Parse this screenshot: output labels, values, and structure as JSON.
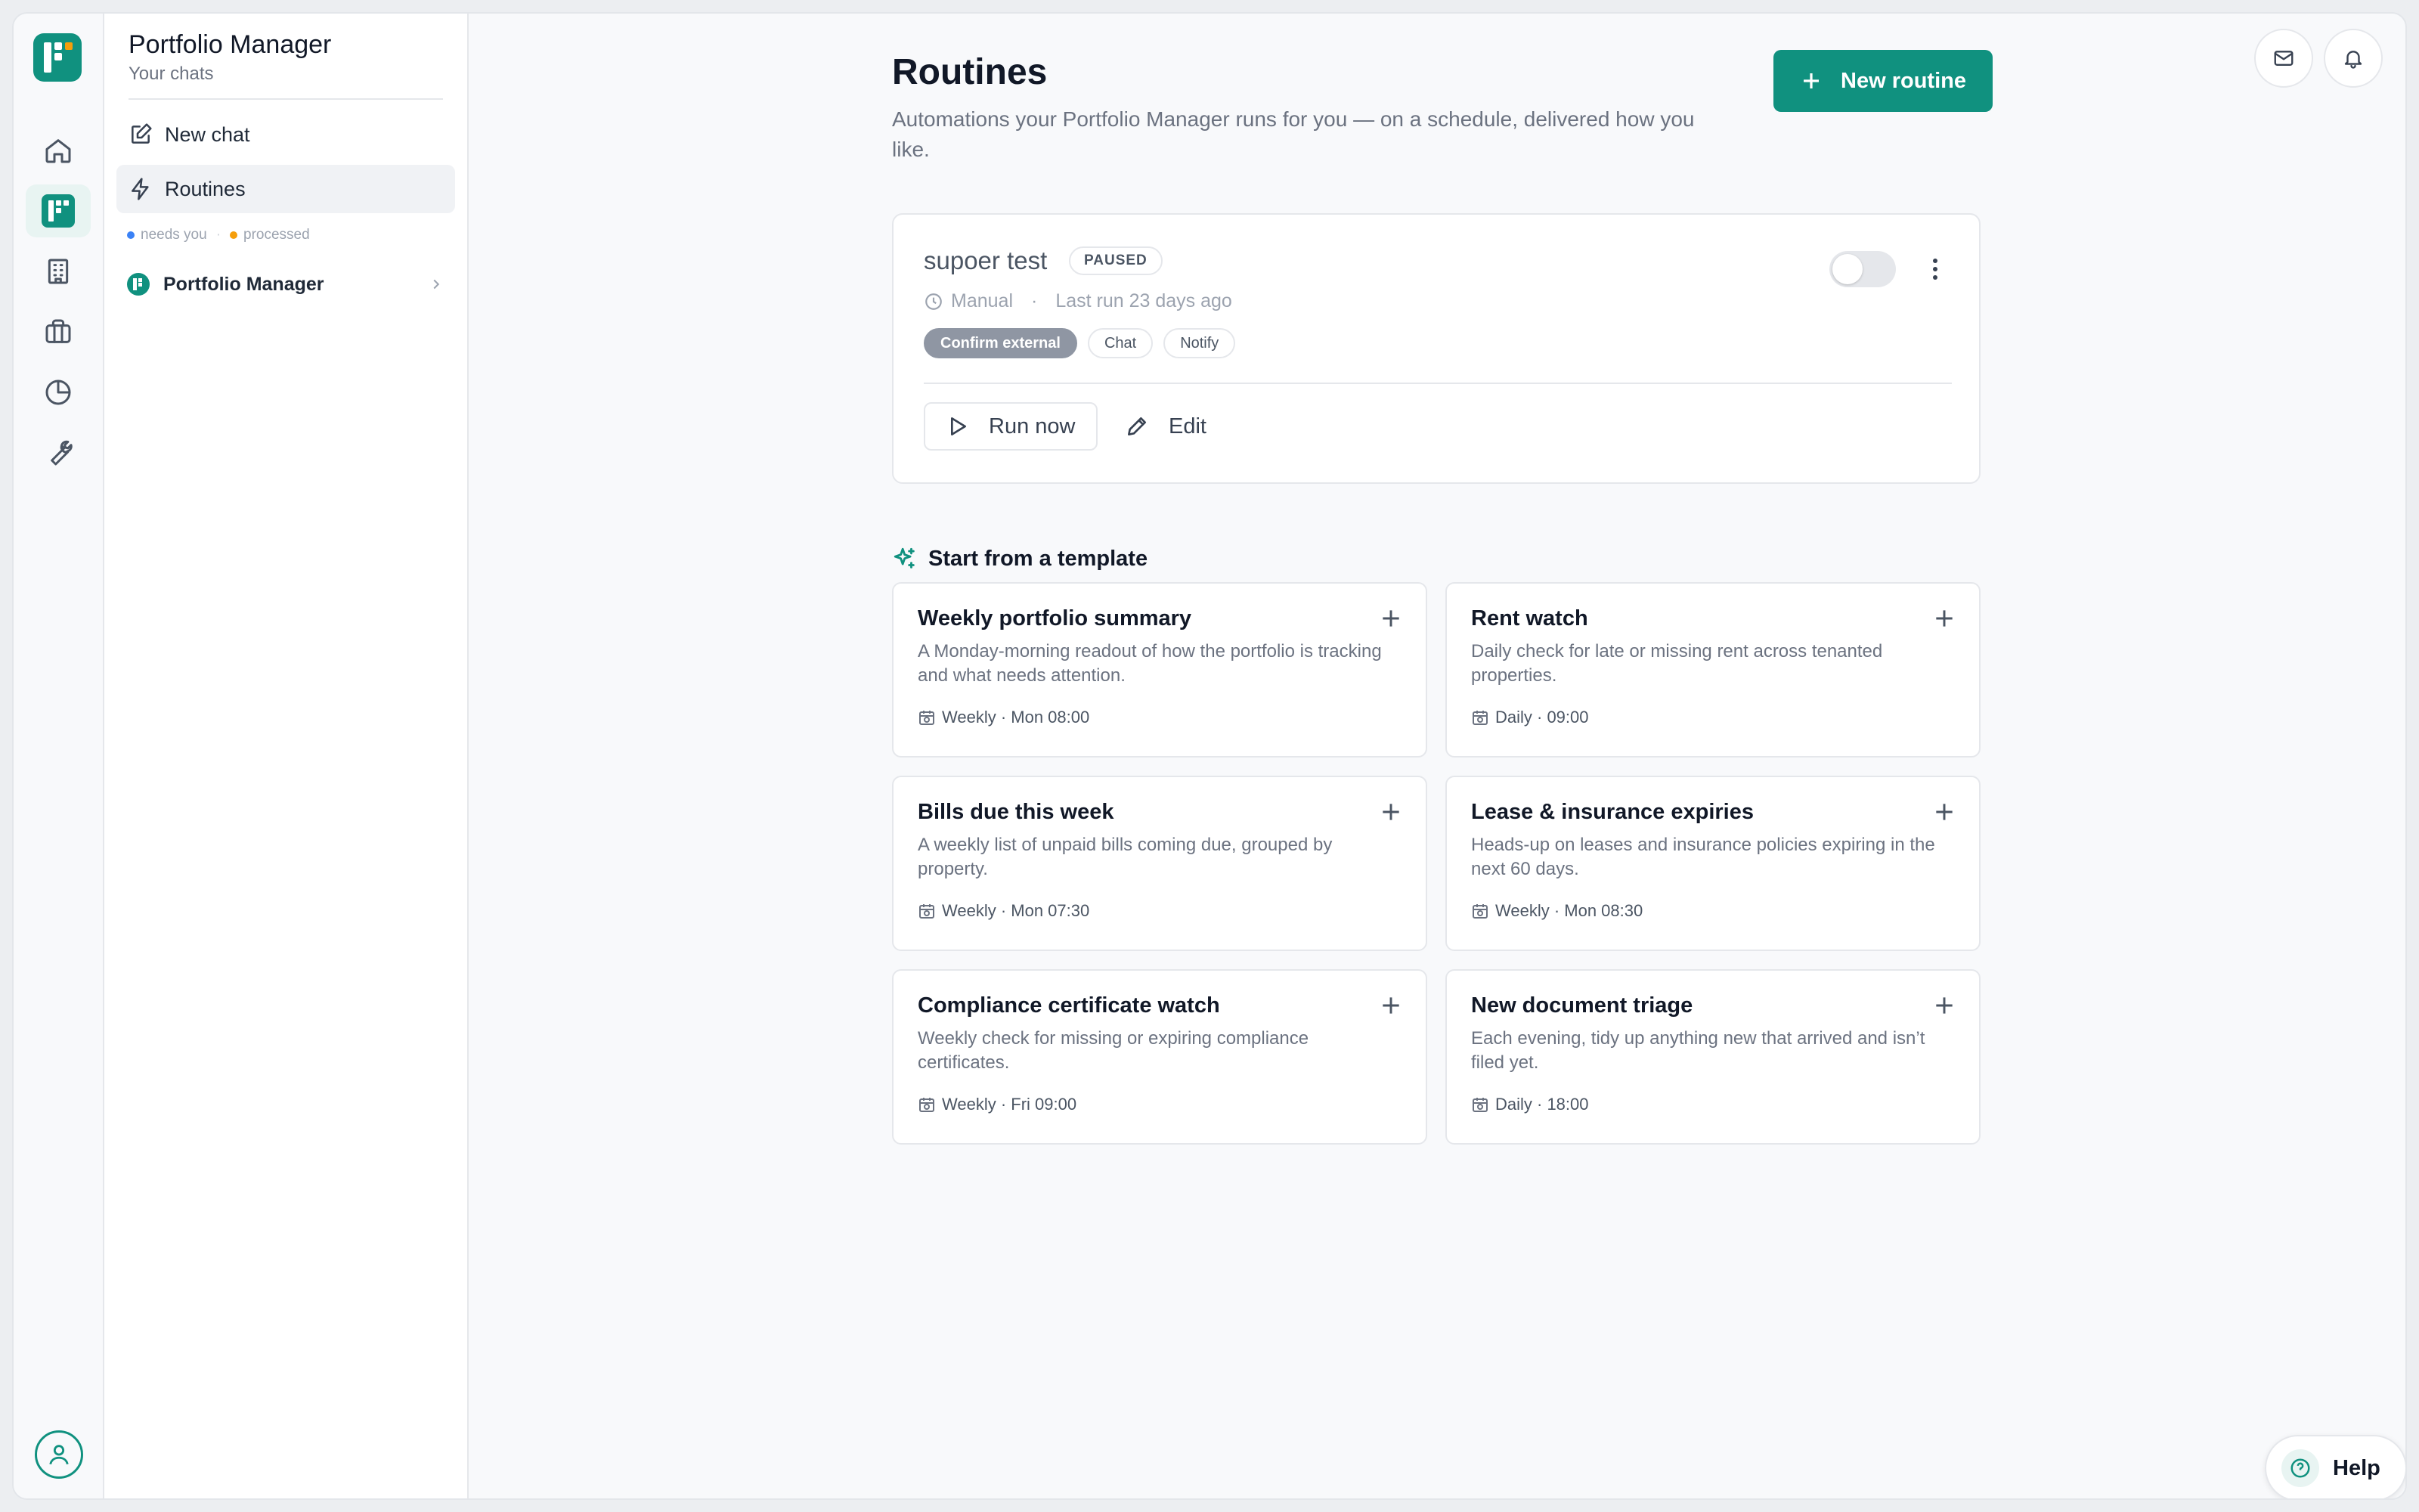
{
  "app": {
    "colors": {
      "accent": "#10917f",
      "paused_chip": "#8f96a3",
      "needs_you": "#3b82f6",
      "processed": "#f59e0b"
    }
  },
  "rail": {
    "items": [
      {
        "icon": "home-icon"
      },
      {
        "icon": "portfolio-manager-logo-icon"
      },
      {
        "icon": "building-icon"
      },
      {
        "icon": "briefcase-icon"
      },
      {
        "icon": "pie-chart-icon"
      },
      {
        "icon": "wrench-icon"
      }
    ],
    "footer_icon": "user-icon"
  },
  "sidebar": {
    "title": "Portfolio Manager",
    "subtitle": "Your chats",
    "new_chat": "New chat",
    "routines": "Routines",
    "legend": {
      "needs_you": "needs you",
      "processed": "processed"
    },
    "chat_item": "Portfolio Manager"
  },
  "header": {
    "title": "Routines",
    "description": "Automations your Portfolio Manager runs for you — on a schedule, delivered how you like.",
    "new_routine": "New routine"
  },
  "routine": {
    "name": "supoer test",
    "status": "PAUSED",
    "trigger": "Manual",
    "last_run": "Last run 23 days ago",
    "chips": [
      "Confirm external",
      "Chat",
      "Notify"
    ],
    "enabled": false,
    "run_now": "Run now",
    "edit": "Edit"
  },
  "templates": {
    "heading": "Start from a template",
    "items": [
      {
        "name": "Weekly portfolio summary",
        "desc": "A Monday-morning readout of how the portfolio is tracking and what needs attention.",
        "schedule": "Weekly · Mon 08:00"
      },
      {
        "name": "Rent watch",
        "desc": "Daily check for late or missing rent across tenanted properties.",
        "schedule": "Daily · 09:00"
      },
      {
        "name": "Bills due this week",
        "desc": "A weekly list of unpaid bills coming due, grouped by property.",
        "schedule": "Weekly · Mon 07:30"
      },
      {
        "name": "Lease & insurance expiries",
        "desc": "Heads-up on leases and insurance policies expiring in the next 60 days.",
        "schedule": "Weekly · Mon 08:30"
      },
      {
        "name": "Compliance certificate watch",
        "desc": "Weekly check for missing or expiring compliance certificates.",
        "schedule": "Weekly · Fri 09:00"
      },
      {
        "name": "New document triage",
        "desc": "Each evening, tidy up anything new that arrived and isn’t filed yet.",
        "schedule": "Daily · 18:00"
      }
    ]
  },
  "help": {
    "label": "Help"
  }
}
